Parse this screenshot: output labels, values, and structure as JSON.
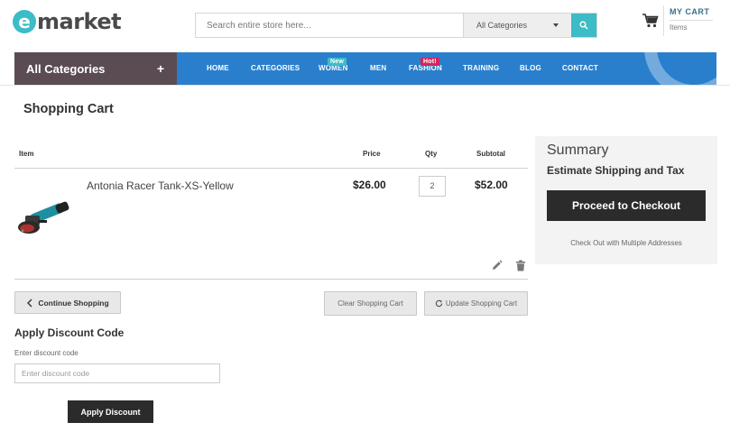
{
  "header": {
    "logo_letter": "e",
    "logo_text": "market",
    "search_placeholder": "Search entire store here...",
    "category_select": "All Categories",
    "cart_title": "MY CART",
    "cart_items_label": "Items"
  },
  "nav": {
    "all_categories_label": "All Categories",
    "all_categories_toggle": "+",
    "items": [
      {
        "label": "HOME"
      },
      {
        "label": "CATEGORIES"
      },
      {
        "label": "WOMEN",
        "badge": "New"
      },
      {
        "label": "MEN"
      },
      {
        "label": "FASHION",
        "badge": "Hot!"
      },
      {
        "label": "TRAINING"
      },
      {
        "label": "BLOG"
      },
      {
        "label": "CONTACT"
      }
    ]
  },
  "cart": {
    "page_title": "Shopping Cart",
    "columns": {
      "item": "Item",
      "price": "Price",
      "qty": "Qty",
      "subtotal": "Subtotal"
    },
    "rows": [
      {
        "name": "Antonia Racer Tank-XS-Yellow",
        "price": "$26.00",
        "qty": "2",
        "subtotal": "$52.00",
        "image": "angle-grinder"
      }
    ],
    "continue_label": "Continue Shopping",
    "clear_label": "Clear Shopping Cart",
    "update_label": "Update Shopping Cart"
  },
  "discount": {
    "title": "Apply Discount Code",
    "label": "Enter discount code",
    "placeholder": "Enter discount code",
    "apply_label": "Apply Discount"
  },
  "summary": {
    "title": "Summary",
    "shipping_label": "Estimate Shipping and Tax",
    "checkout_label": "Proceed to Checkout",
    "multi_address_label": "Check Out with Multiple Addresses"
  },
  "colors": {
    "accent": "#3cbcc6",
    "nav_blue": "#2a7fcc",
    "all_categories_bg": "#5b4c54",
    "hot_badge": "#d2265c",
    "dark_button": "#2b2b2b"
  }
}
